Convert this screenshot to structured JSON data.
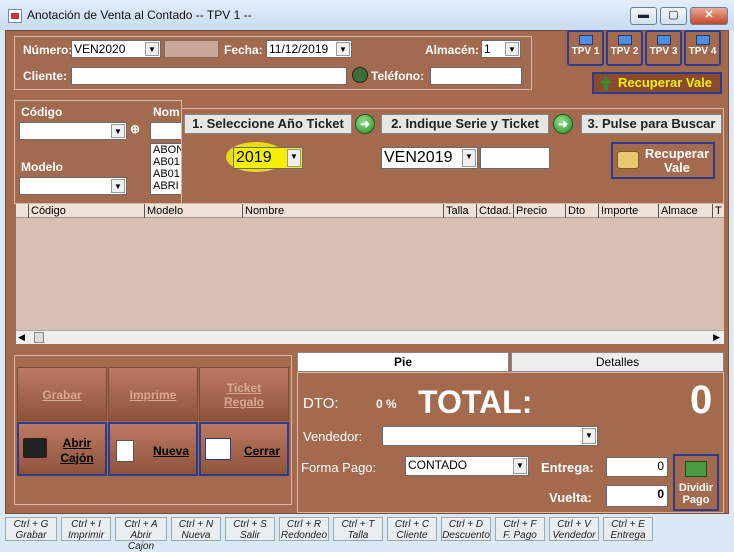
{
  "window": {
    "title": "Anotación de Venta al Contado -- TPV 1 --",
    "controls": [
      "▬",
      "▢",
      "✕"
    ]
  },
  "header": {
    "numero_label": "Número:",
    "numero_value": "VEN2020",
    "fecha_label": "Fecha:",
    "fecha_value": "11/12/2019",
    "almacen_label": "Almacén:",
    "almacen_value": "1",
    "cliente_label": "Cliente:",
    "cliente_value": "",
    "telefono_label": "Teléfono:",
    "telefono_value": ""
  },
  "tpv_buttons": [
    "TPV 1",
    "TPV 2",
    "TPV 3",
    "TPV 4"
  ],
  "recuperar_vale_top": "Recuperar Vale",
  "filters": {
    "codigo_label": "Código",
    "nombre_label": "Nom",
    "modelo_label": "Modelo",
    "nombre_list": [
      "ABON",
      "AB01",
      "AB01",
      "ABRI"
    ]
  },
  "steps": {
    "step1": "1. Seleccione Año Ticket",
    "step2": "2. Indique Serie y Ticket",
    "step3": "3. Pulse para Buscar",
    "year_value": "2019",
    "series_value": "VEN2019",
    "ticket_value": "",
    "recuperar_btn_line1": "Recuperar",
    "recuperar_btn_line2": "Vale"
  },
  "grid": {
    "columns": [
      "Código",
      "Modelo",
      "Nombre",
      "Talla",
      "Ctdad.",
      "Precio",
      "Dto",
      "Importe",
      "Almace",
      "T"
    ]
  },
  "actions": {
    "grabar": "Grabar",
    "imprime": "Imprime",
    "ticket_regalo_1": "Ticket",
    "ticket_regalo_2": "Regalo",
    "abrir_cajon_1": "Abrir",
    "abrir_cajon_2": "Cajón",
    "nueva": "Nueva",
    "cerrar": "Cerrar"
  },
  "tabs": {
    "pie": "Pie",
    "detalles": "Detalles"
  },
  "totals": {
    "dto_label": "DTO:",
    "dto_value": "0 %",
    "total_label": "TOTAL:",
    "total_value": "0",
    "vendedor_label": "Vendedor:",
    "vendedor_value": "",
    "forma_pago_label": "Forma Pago:",
    "forma_pago_value": "CONTADO",
    "entrega_label": "Entrega:",
    "entrega_value": "0",
    "vuelta_label": "Vuelta:",
    "vuelta_value": "0",
    "dividir_pago_1": "Dividir",
    "dividir_pago_2": "Pago"
  },
  "shortcuts": [
    {
      "key": "Ctrl + G",
      "label": "Grabar"
    },
    {
      "key": "Ctrl + I",
      "label": "Imprimir"
    },
    {
      "key": "Ctrl + A",
      "label": "Abrir Cajon"
    },
    {
      "key": "Ctrl + N",
      "label": "Nueva"
    },
    {
      "key": "Ctrl + S",
      "label": "Salir"
    },
    {
      "key": "Ctrl + R",
      "label": "Redondeo"
    },
    {
      "key": "Ctrl + T",
      "label": "Talla"
    },
    {
      "key": "Ctrl + C",
      "label": "Cliente"
    },
    {
      "key": "Ctrl + D",
      "label": "Descuento"
    },
    {
      "key": "Ctrl + F",
      "label": "F. Pago"
    },
    {
      "key": "Ctrl + V",
      "label": "Vendedor"
    },
    {
      "key": "Ctrl + E",
      "label": "Entrega"
    }
  ],
  "colors": {
    "frame": "#a36a4e",
    "accent_border": "#2a3c8f",
    "highlight": "#f5f000"
  }
}
